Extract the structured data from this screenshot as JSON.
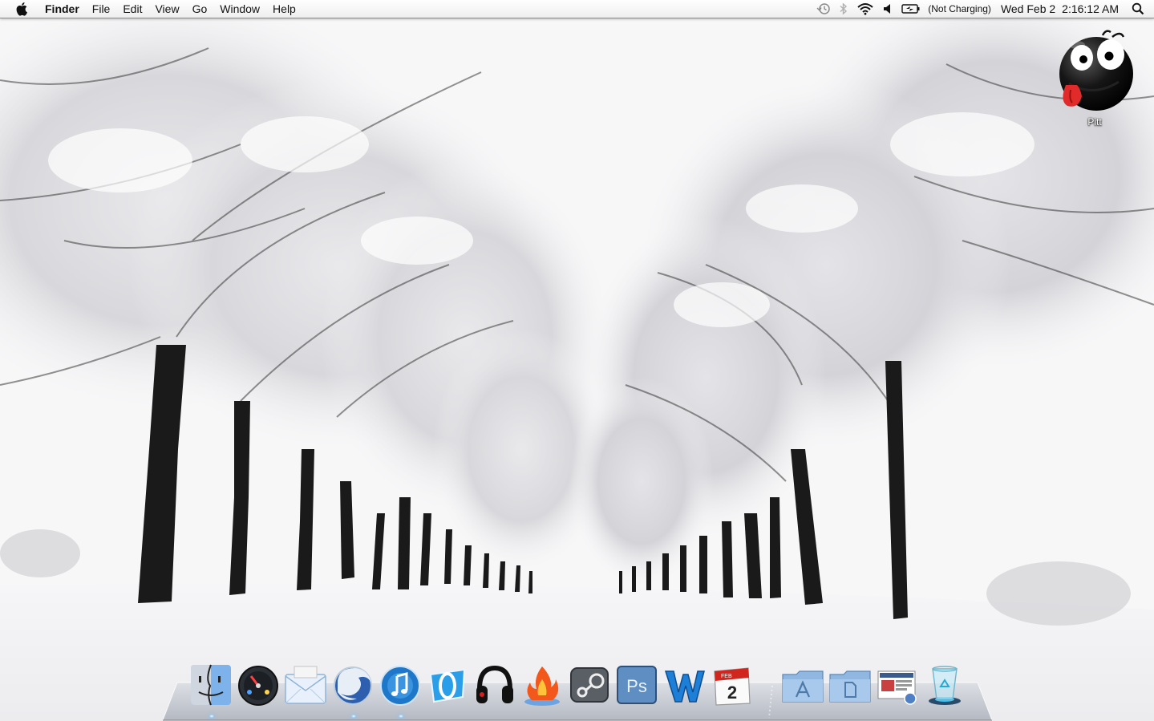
{
  "menubar": {
    "apple_icon": "apple-logo",
    "app_name": "Finder",
    "menus": [
      "File",
      "Edit",
      "View",
      "Go",
      "Window",
      "Help"
    ],
    "status": {
      "time_machine_icon": "clock-arrow-icon",
      "bluetooth_icon": "bluetooth-icon",
      "wifi_icon": "wifi-icon",
      "volume_icon": "speaker-icon",
      "battery_icon": "battery-charging-icon",
      "battery_text": "(Not Charging)",
      "date": "Wed Feb 2",
      "time": "2:16:12 AM",
      "spotlight_icon": "magnifier-icon"
    }
  },
  "desktop": {
    "wallpaper": "snowy tree-lined road",
    "icons": [
      {
        "label": "Pitt",
        "icon": "black-smiley-tongue-icon"
      }
    ]
  },
  "dock": {
    "items": [
      {
        "name": "Finder",
        "icon": "finder-icon",
        "running": true
      },
      {
        "name": "Dashboard",
        "icon": "dashboard-icon",
        "running": false
      },
      {
        "name": "Mail",
        "icon": "mail-icon",
        "running": false
      },
      {
        "name": "Firefox",
        "icon": "firefox-icon",
        "running": true
      },
      {
        "name": "iTunes",
        "icon": "itunes-icon",
        "running": true
      },
      {
        "name": "Opera",
        "icon": "opera-icon",
        "running": false
      },
      {
        "name": "Beats",
        "icon": "headphones-icon",
        "running": false
      },
      {
        "name": "Flame",
        "icon": "flame-icon",
        "running": false
      },
      {
        "name": "Steam",
        "icon": "steam-icon",
        "running": false
      },
      {
        "name": "Photoshop",
        "icon": "photoshop-icon",
        "running": false
      },
      {
        "name": "Word",
        "icon": "word-icon",
        "running": false
      },
      {
        "name": "Calendar",
        "icon": "calendar-icon",
        "running": false,
        "calendar_month": "FEB",
        "calendar_day": "2"
      },
      {
        "name": "Applications",
        "icon": "applications-folder-icon",
        "running": false
      },
      {
        "name": "Documents",
        "icon": "documents-folder-icon",
        "running": false
      },
      {
        "name": "Downloads",
        "icon": "downloads-stack-icon",
        "running": false
      },
      {
        "name": "Trash",
        "icon": "trash-icon",
        "running": false
      }
    ]
  },
  "colors": {
    "menubar_bg": "#f0f0f0",
    "dock_glow": "#7ac4ff",
    "photoshop_blue": "#5f8fc2",
    "word_blue": "#1d7fd8",
    "itunes_blue": "#1f77c9",
    "calendar_red": "#d0261e"
  }
}
